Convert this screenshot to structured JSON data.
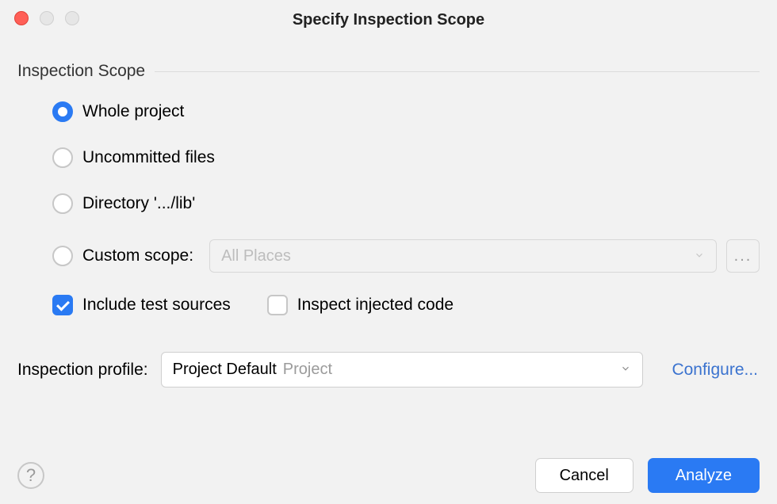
{
  "title": "Specify Inspection Scope",
  "group": {
    "label": "Inspection Scope"
  },
  "options": {
    "whole_project": "Whole project",
    "uncommitted": "Uncommitted files",
    "directory": "Directory '.../lib'",
    "custom_scope": "Custom scope:"
  },
  "custom_scope_select": {
    "placeholder": "All Places"
  },
  "checks": {
    "include_tests": "Include test sources",
    "inspect_injected": "Inspect injected code"
  },
  "profile": {
    "label": "Inspection profile:",
    "value": "Project Default",
    "hint": "Project",
    "configure": "Configure..."
  },
  "buttons": {
    "cancel": "Cancel",
    "analyze": "Analyze"
  },
  "help": "?"
}
